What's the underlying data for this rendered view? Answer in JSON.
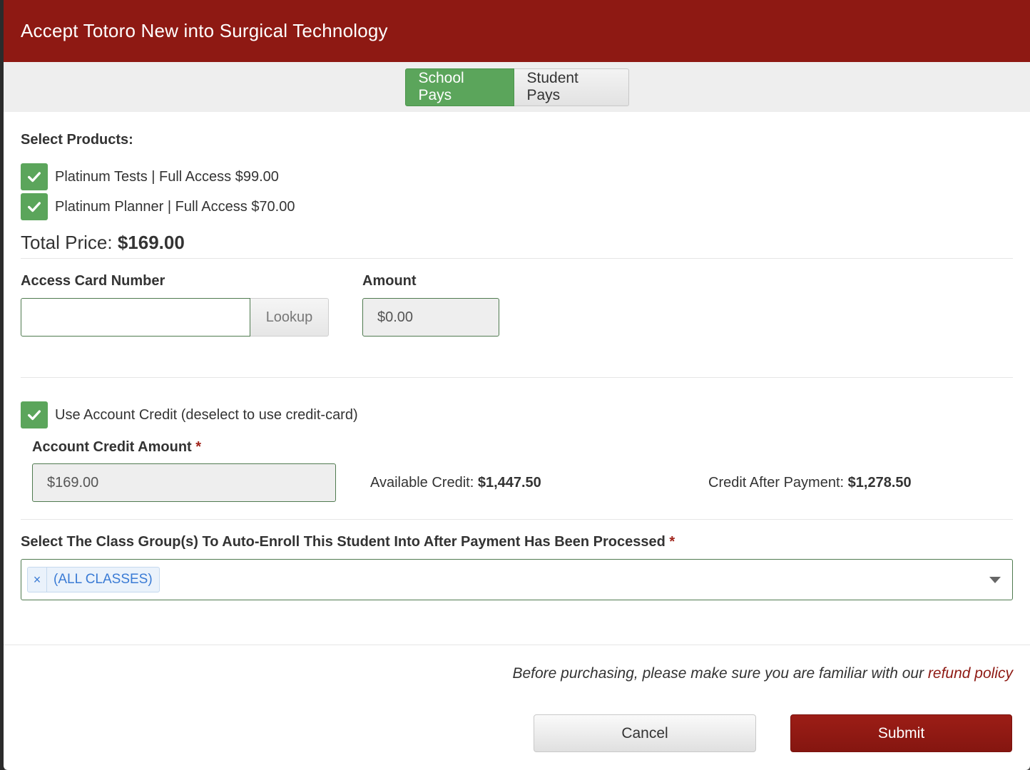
{
  "modal": {
    "title": "Accept Totoro New into Surgical Technology"
  },
  "payment_toggle": {
    "school_pays": "School Pays",
    "student_pays": "Student Pays",
    "selected": "School Pays"
  },
  "products": {
    "label": "Select Products:",
    "items": [
      {
        "label": "Platinum Tests | Full Access $99.00",
        "checked": true
      },
      {
        "label": "Platinum Planner | Full Access $70.00",
        "checked": true
      }
    ],
    "total_label": "Total Price:",
    "total_value": "$169.00"
  },
  "access_card": {
    "label": "Access Card Number",
    "value": "",
    "lookup_label": "Lookup",
    "amount_label": "Amount",
    "amount_value": "$0.00"
  },
  "account_credit": {
    "checkbox_label": "Use Account Credit (deselect to use credit-card)",
    "checked": true,
    "amount_label": "Account Credit Amount",
    "required_mark": "*",
    "amount_value": "$169.00",
    "available_label": "Available Credit:",
    "available_value": "$1,447.50",
    "after_label": "Credit After Payment:",
    "after_value": "$1,278.50"
  },
  "class_group": {
    "label": "Select The Class Group(s) To Auto-Enroll This Student Into After Payment Has Been Processed",
    "required_mark": "*",
    "tags": [
      {
        "label": "(ALL CLASSES)",
        "remove": "×"
      }
    ]
  },
  "footer": {
    "note": "Before purchasing, please make sure you are familiar with our",
    "link": "refund policy",
    "cancel_label": "Cancel",
    "submit_label": "Submit"
  },
  "colors": {
    "header": "#8e1913",
    "accent_green": "#5ba55b",
    "link": "#8e1913"
  }
}
